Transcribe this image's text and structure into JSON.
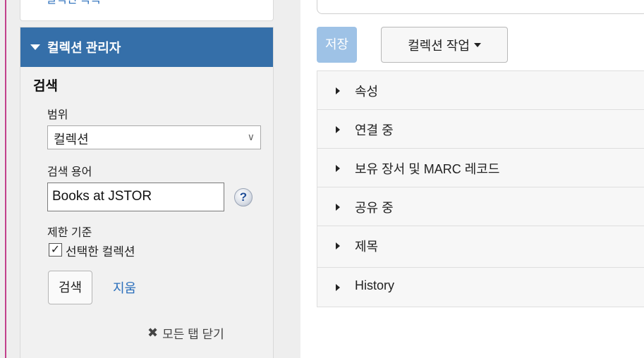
{
  "sidebar": {
    "prev_panel_label": "컬렉션 목록",
    "collection_manager": {
      "title": "컬렉션 관리자",
      "search_heading": "검색",
      "scope_label": "범위",
      "scope_value": "컬렉션",
      "term_label": "검색 용어",
      "term_value": "Books at JSTOR",
      "help_glyph": "?",
      "limit_label": "제한 기준",
      "limit_checkbox_label": "선택한 컬렉션",
      "limit_checked": "✓",
      "search_button": "검색",
      "clear_link": "지움",
      "close_all_tabs": "모든 탭 닫기"
    }
  },
  "main": {
    "save_button": "저장",
    "actions_button": "컬렉션 작업",
    "sections": [
      {
        "label": "속성"
      },
      {
        "label": "연결 중"
      },
      {
        "label": "보유 장서 및 MARC 레코드"
      },
      {
        "label": "공유 중"
      },
      {
        "label": "제목"
      },
      {
        "label": "History"
      }
    ]
  },
  "colors": {
    "header_blue": "#356fa9",
    "link_blue": "#2a6ebb",
    "save_disabled": "#9ec2e6",
    "left_rule": "#c2418c"
  }
}
